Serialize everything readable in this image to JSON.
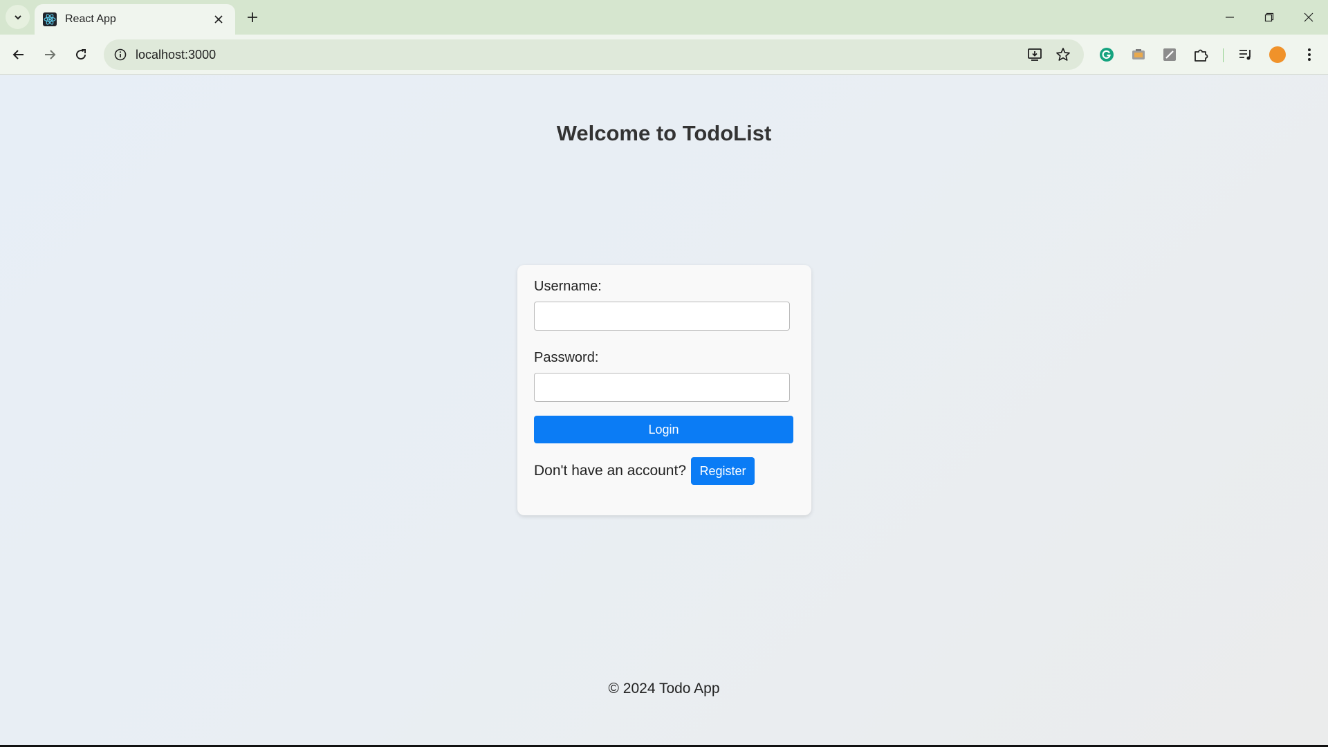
{
  "browser": {
    "tab_title": "React App",
    "url": "localhost:3000",
    "profile_color": "#f0922a",
    "tab_bar_color": "#d6e6cf"
  },
  "page": {
    "title": "Welcome to TodoList",
    "login_form": {
      "username_label": "Username:",
      "username_value": "",
      "password_label": "Password:",
      "password_value": "",
      "login_button": "Login",
      "register_prompt": "Don't have an account?",
      "register_button": "Register"
    },
    "footer": "© 2024 Todo App",
    "accent_color": "#0b7cf5"
  }
}
